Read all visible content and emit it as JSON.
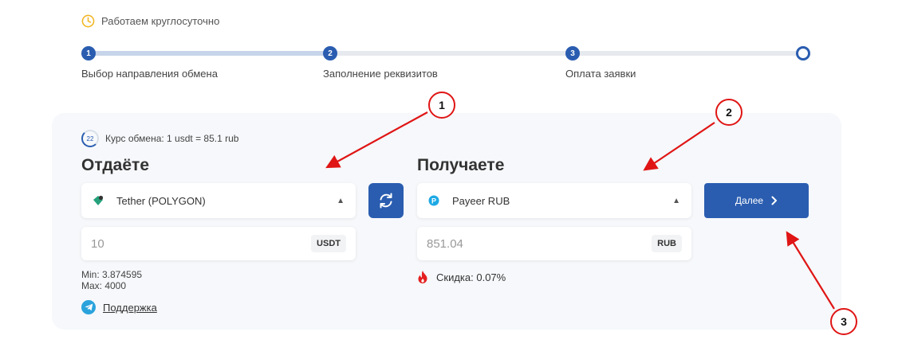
{
  "notice": {
    "text": "Работаем круглосуточно",
    "icon": "clock-icon"
  },
  "stepper": {
    "steps": [
      {
        "number": "1",
        "label": "Выбор направления обмена"
      },
      {
        "number": "2",
        "label": "Заполнение реквизитов"
      },
      {
        "number": "3",
        "label": "Оплата заявки"
      },
      {
        "number": "",
        "label": ""
      }
    ]
  },
  "rate": {
    "timer": "22",
    "text": "Курс обмена: 1 usdt = 85.1 rub"
  },
  "give": {
    "heading": "Отдаёте",
    "currency": "Tether (POLYGON)",
    "amount": "10",
    "unit": "USDT",
    "min": "Min: 3.874595",
    "max": "Max: 4000"
  },
  "receive": {
    "heading": "Получаете",
    "currency": "Payeer RUB",
    "amount": "851.04",
    "unit": "RUB",
    "discount": "Скидка: 0.07%"
  },
  "next_button": {
    "label": "Далее"
  },
  "support": {
    "label": "Поддержка"
  },
  "annotations": {
    "marker1": "1",
    "marker2": "2",
    "marker3": "3"
  },
  "colors": {
    "accent": "#2a5db0",
    "annotation": "#e01515",
    "panel": "#f6f8fb"
  }
}
